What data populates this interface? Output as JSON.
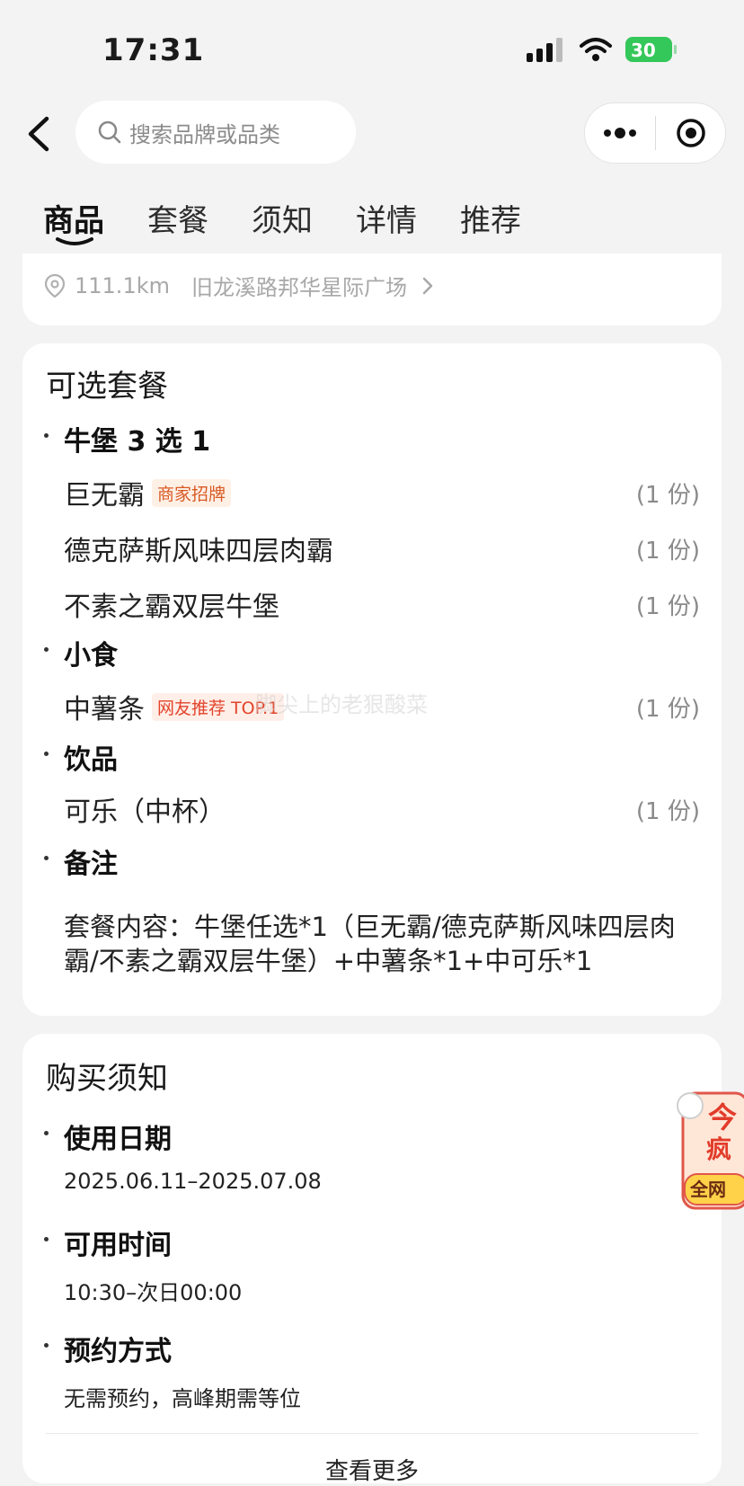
{
  "status_bar": {
    "time": "17:31",
    "battery": "30"
  },
  "nav": {
    "search_placeholder": "搜索品牌或品类"
  },
  "tabs": [
    {
      "label": "商品",
      "active": true
    },
    {
      "label": "套餐"
    },
    {
      "label": "须知"
    },
    {
      "label": "详情"
    },
    {
      "label": "推荐"
    }
  ],
  "store": {
    "distance": "111.1km",
    "address": "旧龙溪路邦华星际广场"
  },
  "package": {
    "title": "可选套餐",
    "groups": [
      {
        "title": "牛堡 3 选 1",
        "items": [
          {
            "name": "巨无霸",
            "tag": "商家招牌",
            "qty": "(1 份)"
          },
          {
            "name": "德克萨斯风味四层肉霸",
            "qty": "(1 份)"
          },
          {
            "name": "不素之霸双层牛堡",
            "qty": "(1 份)"
          }
        ]
      },
      {
        "title": "小食",
        "items": [
          {
            "name": "中薯条",
            "tag": "网友推荐 TOP.1",
            "qty": "(1 份)"
          }
        ]
      },
      {
        "title": "饮品",
        "items": [
          {
            "name": "可乐（中杯）",
            "qty": "(1 份)"
          }
        ]
      }
    ],
    "note_title": "备注",
    "note_text": "套餐内容：牛堡任选*1（巨无霸/德克萨斯风味四层肉霸/不素之霸双层牛堡）+中薯条*1+中可乐*1"
  },
  "notice": {
    "title": "购买须知",
    "sections": [
      {
        "title": "使用日期",
        "value": "2025.06.11–2025.07.08"
      },
      {
        "title": "可用时间",
        "value": "10:30–次日00:00"
      },
      {
        "title": "预约方式",
        "value": "无需预约，高峰期需等位"
      }
    ],
    "view_more": "查看更多"
  },
  "watermark": "脚尖上的老狠酸菜",
  "float_ad": {
    "line1": "今",
    "line2": "疯",
    "badge": "全网"
  },
  "colors": {
    "accent_orange": "#d85a24",
    "accent_red": "#e2432b",
    "battery_green": "#34c759"
  }
}
